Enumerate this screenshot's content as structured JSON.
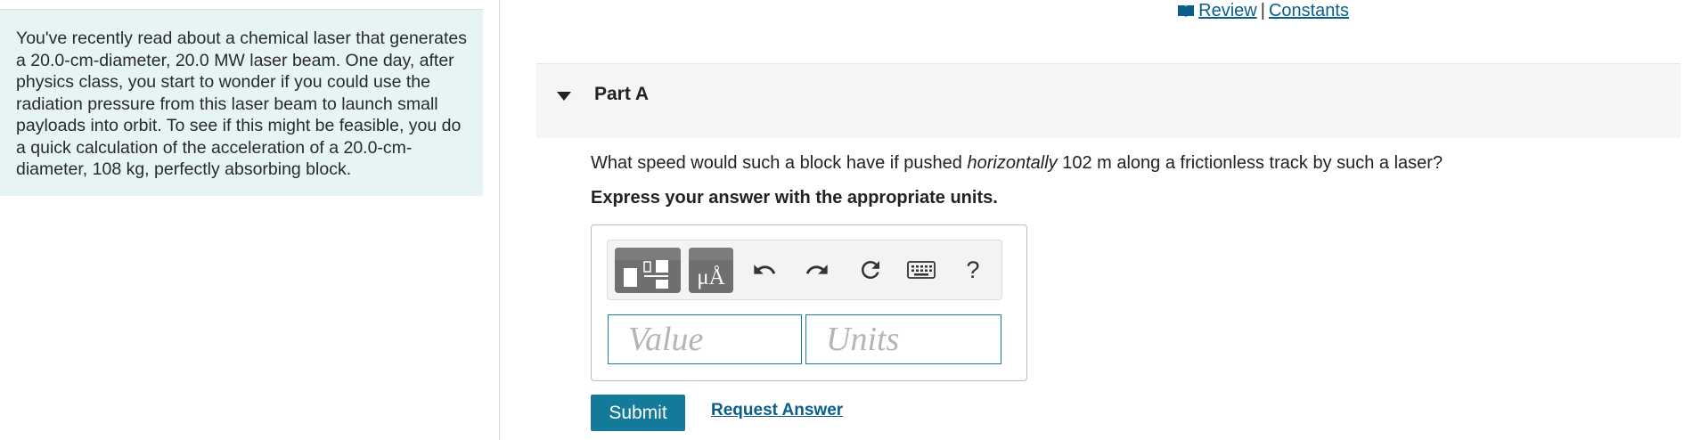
{
  "intro": {
    "text": "You've recently read about a chemical laser that generates a 20.0-cm-diameter, 20.0 MW laser beam. One day, after physics class, you start to wonder if you could use the radiation pressure from this laser beam to launch small payloads into orbit. To see if this might be feasible, you do a quick calculation of the acceleration of a 20.0-cm-diameter, 108 kg, perfectly absorbing block."
  },
  "top_links": {
    "review_icon": "book-icon",
    "review_label": "Review",
    "separator": "|",
    "constants_label": "Constants"
  },
  "part": {
    "title": "Part A",
    "toggle_icon": "caret-down-icon",
    "question_before": "What speed would such a block have if pushed ",
    "question_emphasis": "horizontally",
    "question_after": " 102 m along a frictionless track by such a laser?",
    "instruction": "Express your answer with the appropriate units."
  },
  "toolbar": {
    "icons": [
      "templates-icon",
      "units-icon",
      "undo-icon",
      "redo-icon",
      "reset-icon",
      "keyboard-icon",
      "help-icon"
    ],
    "units_glyph": "μÅ",
    "help_glyph": "?"
  },
  "inputs": {
    "value_placeholder": "Value",
    "value": "",
    "units_placeholder": "Units",
    "units": ""
  },
  "actions": {
    "submit_label": "Submit",
    "request_label": "Request Answer"
  },
  "colors": {
    "intro_background": "#e6f4f4",
    "accent": "#147a99",
    "link": "#0b5e8a"
  }
}
